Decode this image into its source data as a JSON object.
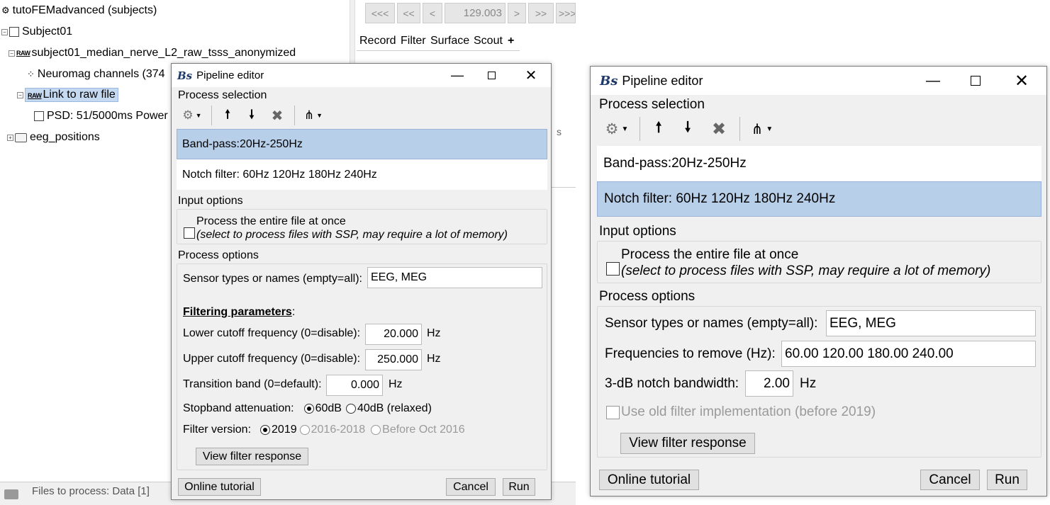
{
  "background_app": {
    "tree": {
      "root": "tutoFEMadvanced (subjects)",
      "subject": "Subject01",
      "raw_folder": "subject01_median_nerve_L2_raw_tsss_anonymized",
      "raw_badge": "RAW",
      "channels": "Neuromag channels (374",
      "link": "Link to raw file",
      "psd": "PSD: 51/5000ms Power",
      "eeg_folder": "eeg_positions"
    },
    "nav": {
      "first": "<<<",
      "prev_page": "<<",
      "prev": "<",
      "time": "129.003",
      "next": ">",
      "next_page": ">>",
      "last": ">>>"
    },
    "tabs": [
      "Record",
      "Filter",
      "Surface",
      "Scout",
      "+"
    ],
    "partial_text": "s",
    "status": "Files to process: Data [1]"
  },
  "dialog1": {
    "title": "Pipeline editor",
    "logo": "Bs",
    "process_selection_label": "Process selection",
    "processes": [
      {
        "label": "Band-pass:20Hz-250Hz",
        "selected": true
      },
      {
        "label": "Notch filter: 60Hz 120Hz 180Hz 240Hz",
        "selected": false
      }
    ],
    "input_options_label": "Input options",
    "entire_file_label": "Process the entire file at once",
    "entire_file_note": "(select to process files with SSP, may require a lot of memory)",
    "process_options_label": "Process options",
    "sensor_label": "Sensor types or names (empty=all):",
    "sensor_value": "EEG, MEG",
    "filtering_header": "Filtering parameters",
    "filtering_colon": ":",
    "lower_label": "Lower cutoff frequency (0=disable):",
    "lower_value": "20.000",
    "upper_label": "Upper cutoff frequency (0=disable):",
    "upper_value": "250.000",
    "transition_label": "Transition band (0=default):",
    "transition_value": "0.000",
    "hz": "Hz",
    "stopband_label": "Stopband attenuation:",
    "stopband_opt1": "60dB",
    "stopband_opt2": "40dB (relaxed)",
    "version_label": "Filter version:",
    "version_opt1": "2019",
    "version_opt2": "2016-2018",
    "version_opt3": "Before Oct 2016",
    "view_response": "View filter response",
    "online_tutorial": "Online tutorial",
    "cancel": "Cancel",
    "run": "Run"
  },
  "dialog2": {
    "title": "Pipeline editor",
    "logo": "Bs",
    "process_selection_label": "Process selection",
    "processes": [
      {
        "label": "Band-pass:20Hz-250Hz",
        "selected": false
      },
      {
        "label": "Notch filter: 60Hz 120Hz 180Hz 240Hz",
        "selected": true
      }
    ],
    "input_options_label": "Input options",
    "entire_file_label": "Process the entire file at once",
    "entire_file_note": "(select to process files with SSP, may require a lot of memory)",
    "process_options_label": "Process options",
    "sensor_label": "Sensor types or names (empty=all):",
    "sensor_value": "EEG, MEG",
    "freq_label": "Frequencies to remove (Hz):",
    "freq_value": "60.00 120.00 180.00 240.00",
    "bandwidth_label": "3-dB notch bandwidth:",
    "bandwidth_value": "2.00",
    "hz": "Hz",
    "old_filter_label": "Use old filter implementation (before 2019)",
    "view_response": "View filter response",
    "online_tutorial": "Online tutorial",
    "cancel": "Cancel",
    "run": "Run"
  },
  "icons": [
    "gear-icon",
    "arrow-up-icon",
    "arrow-down-icon",
    "delete-icon",
    "pipeline-tree-icon",
    "minimize-icon",
    "maximize-icon",
    "close-icon"
  ],
  "colors": {
    "selection": "#b8cfe9",
    "dialog_bg": "#f0f0f0",
    "logo": "#1f3a68"
  }
}
